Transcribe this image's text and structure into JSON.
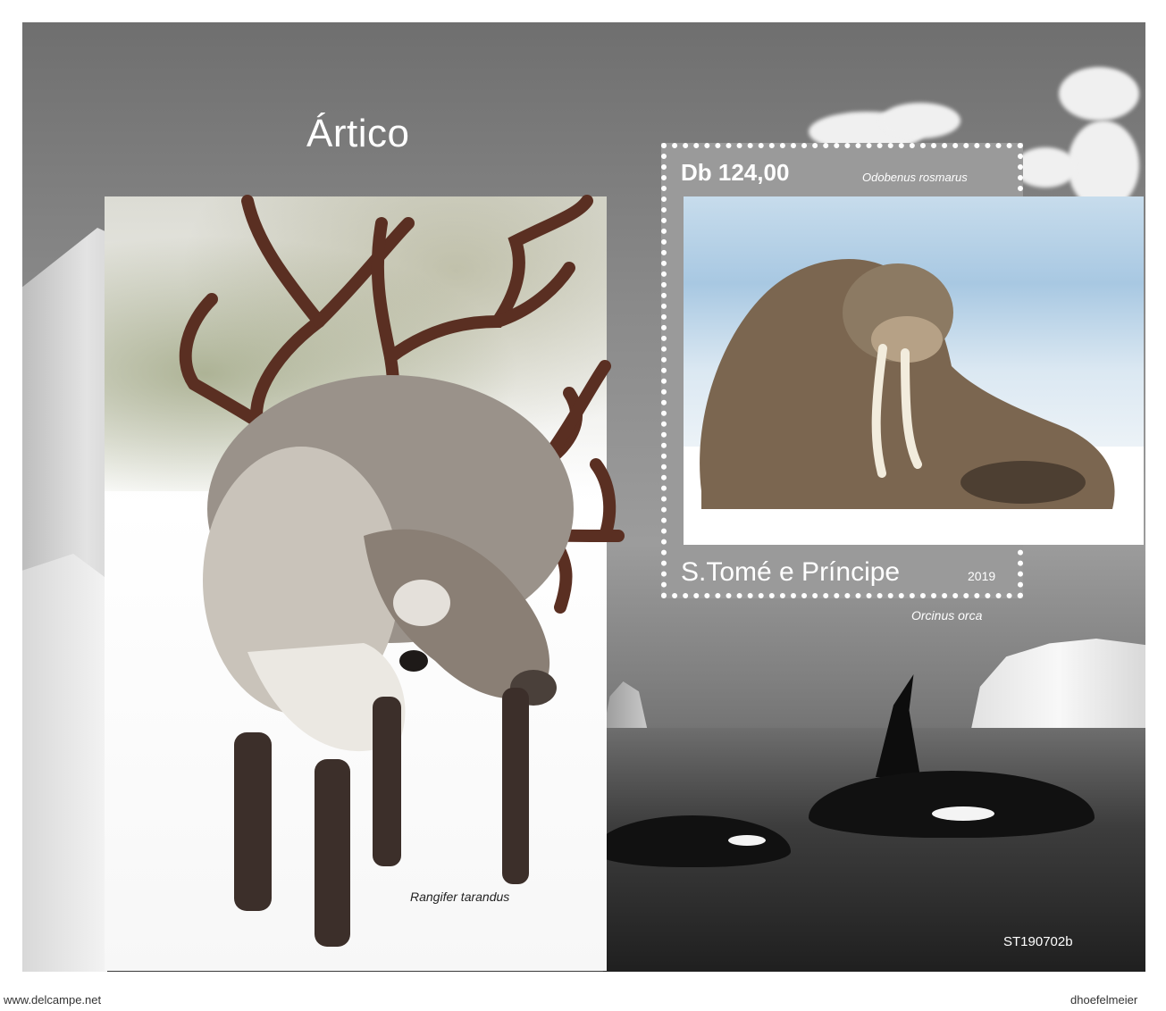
{
  "sheet": {
    "title": "Ártico",
    "catalog_code": "ST190702b"
  },
  "stamp": {
    "denomination": "Db 124,00",
    "walrus_species": "Odobenus rosmarus",
    "country": "S.Tomé e Príncipe",
    "year": "2019"
  },
  "captions": {
    "orca_species": "Orcinus orca",
    "reindeer_species": "Rangifer tarandus"
  },
  "watermarks": {
    "left": "www.delcampe.net",
    "right": "dhoefelmeier"
  }
}
